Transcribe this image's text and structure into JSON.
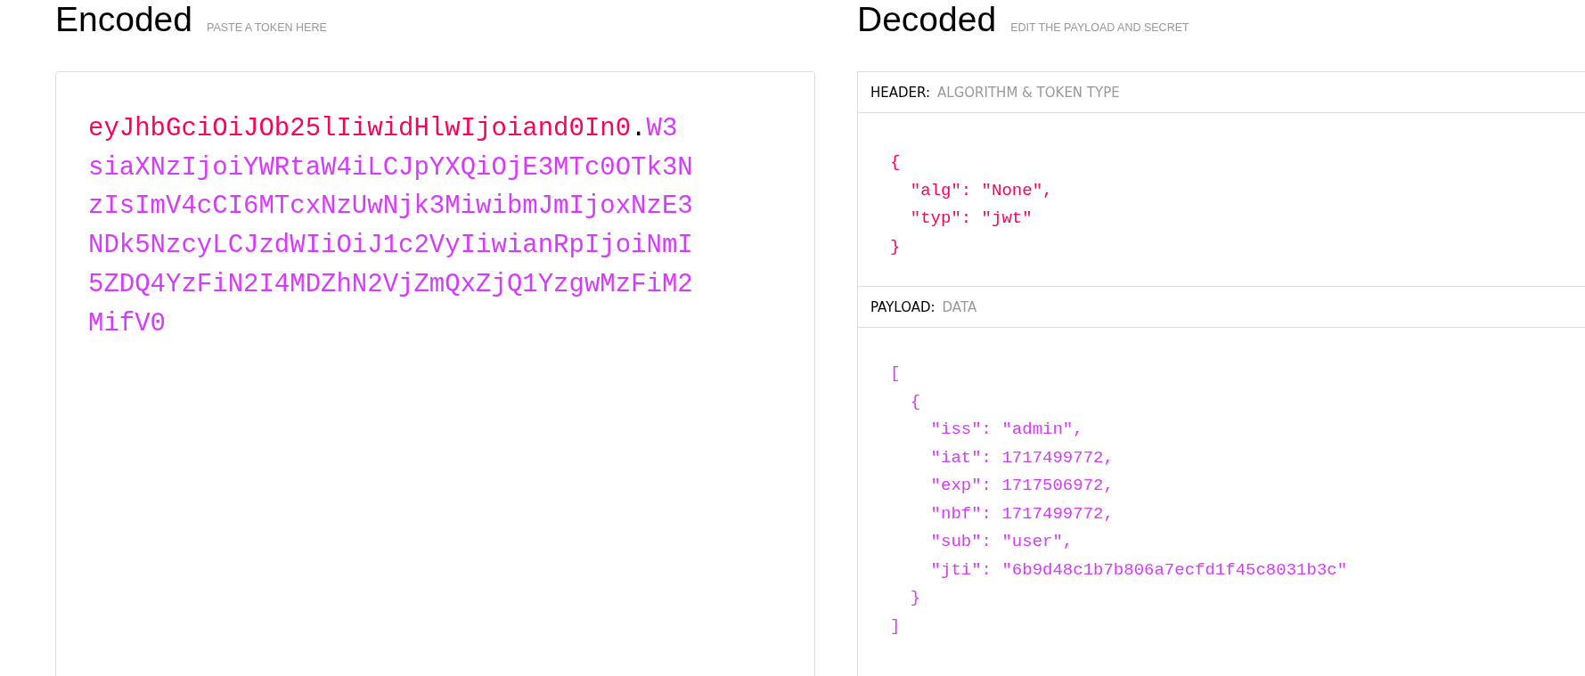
{
  "encoded": {
    "title": "Encoded",
    "subtitle": "PASTE A TOKEN HERE",
    "token": [
      {
        "kind": "header",
        "text": "eyJhbGciOiJOb25lIiwidHlwIjoiand0In0"
      },
      {
        "kind": "dot",
        "text": "."
      },
      {
        "kind": "payload",
        "text": "W3siaXNzIjoiYWRtaW4iLCJpYXQiOjE3MTc0OTk3NzIsImV4cCI6MTcxNzUwNjk3MiwibmJmIjoxNzE3NDk5NzcyLCJzdWIiOiJ1c2VyIiwianRpIjoiNmI5ZDQ4YzFiN2I4MDZhN2VjZmQxZjQ1YzgwMzFiM2MifV0"
      }
    ]
  },
  "decoded": {
    "title": "Decoded",
    "subtitle": "EDIT THE PAYLOAD AND SECRET",
    "sections": [
      {
        "kind": "header",
        "label": "HEADER:",
        "sublabel": "ALGORITHM & TOKEN TYPE",
        "code": "{\n  \"alg\": \"None\",\n  \"typ\": \"jwt\"\n}"
      },
      {
        "kind": "payload",
        "label": "PAYLOAD:",
        "sublabel": "DATA",
        "code": "[\n  {\n    \"iss\": \"admin\",\n    \"iat\": 1717499772,\n    \"exp\": 1717506972,\n    \"nbf\": 1717499772,\n    \"sub\": \"user\",\n    \"jti\": \"6b9d48c1b7b806a7ecfd1f45c8031b3c\"\n  }\n]"
      }
    ]
  }
}
